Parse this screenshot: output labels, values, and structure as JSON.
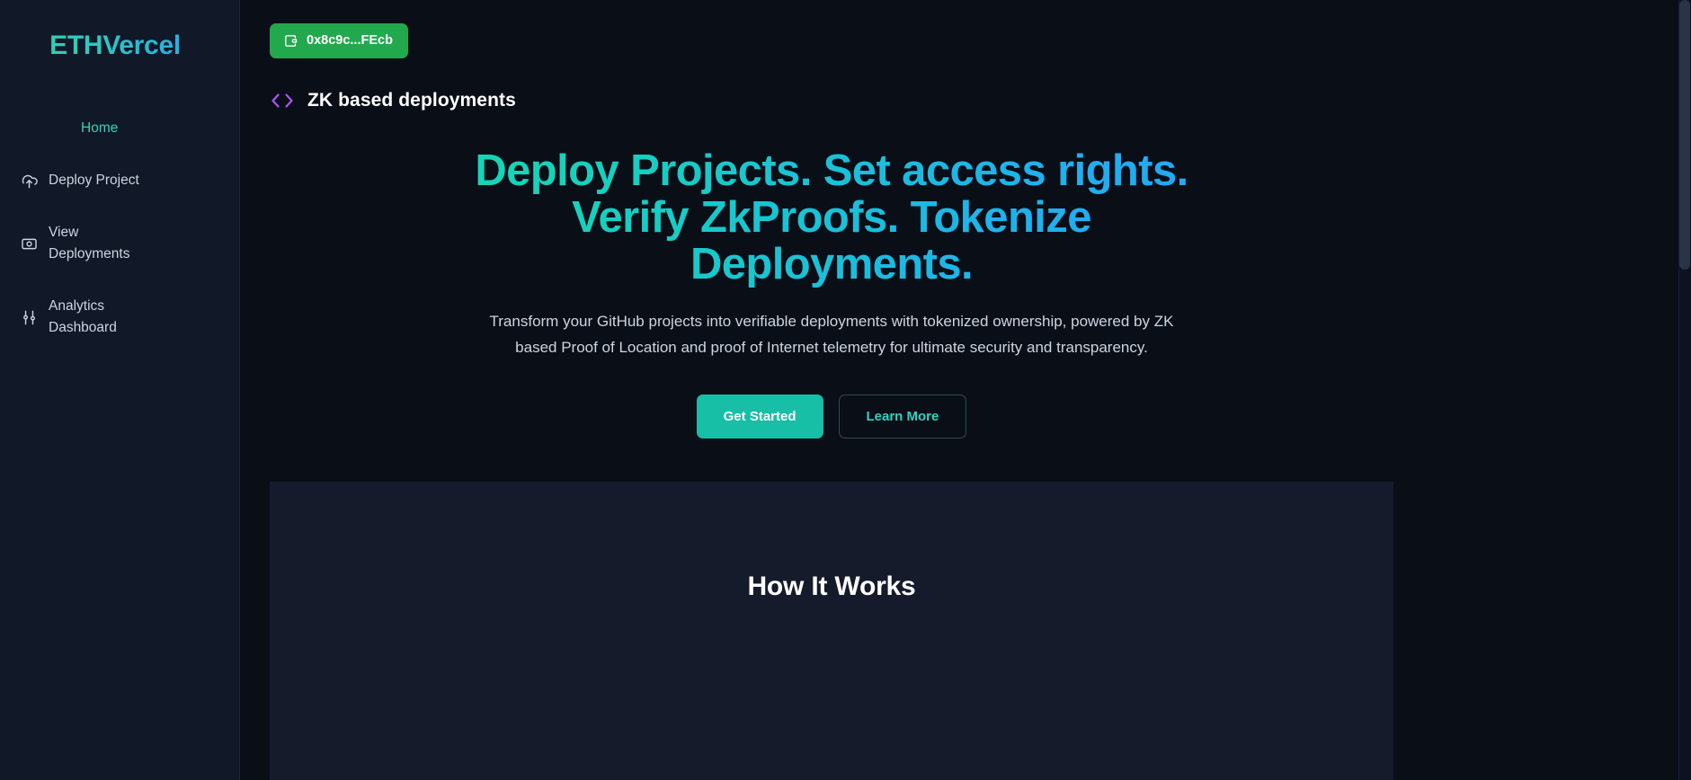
{
  "sidebar": {
    "brand": "ETHVercel",
    "items": [
      {
        "label": "Home",
        "icon": "home-icon",
        "active": true
      },
      {
        "label": "Deploy Project",
        "icon": "cloud-upload-icon",
        "active": false
      },
      {
        "label": "View Deployments",
        "icon": "eye-icon",
        "active": false
      },
      {
        "label": "Analytics Dashboard",
        "icon": "sliders-icon",
        "active": false
      }
    ]
  },
  "topbar": {
    "wallet_label": "0x8c9c...FEcb",
    "wallet_icon": "wallet-icon",
    "wallet_color": "#22a94e"
  },
  "page": {
    "title": "ZK based deployments",
    "title_icon": "code-brackets-icon",
    "title_icon_color": "#a855f7"
  },
  "hero": {
    "heading": "Deploy Projects. Set access rights. Verify ZkProofs. Tokenize Deployments.",
    "subtitle": "Transform your GitHub projects into verifiable deployments with tokenized ownership, powered by ZK based Proof of Location and proof of Internet telemetry for ultimate security and transparency.",
    "primary_cta": "Get Started",
    "secondary_cta": "Learn More",
    "gradient_start": "#15d6b4",
    "gradient_end": "#22a7f5"
  },
  "how_it_works": {
    "title": "How It Works"
  }
}
